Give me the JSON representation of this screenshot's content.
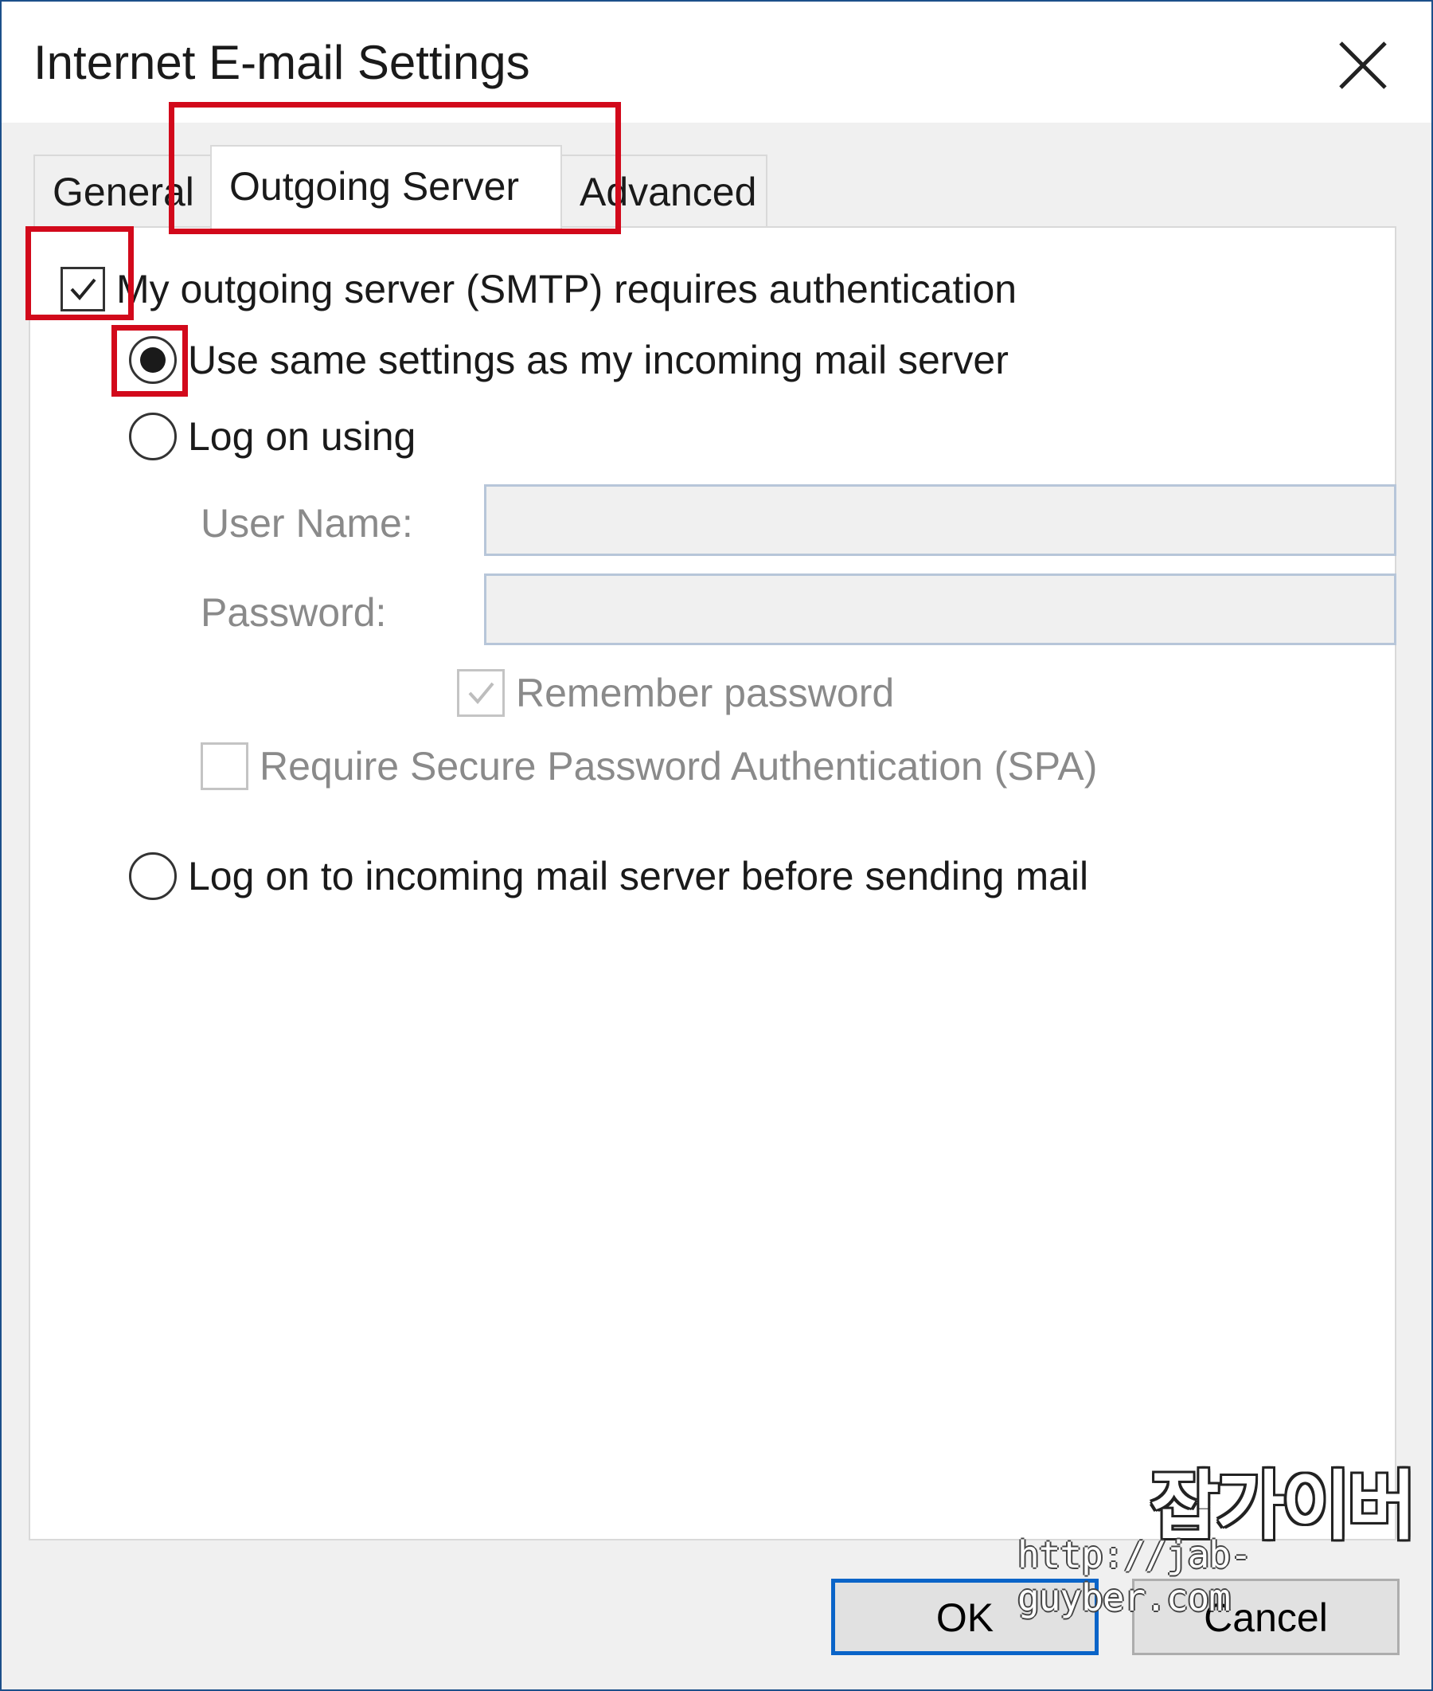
{
  "window": {
    "title": "Internet E-mail Settings",
    "close_icon": "close-icon"
  },
  "tabs": [
    {
      "label": "General",
      "active": false
    },
    {
      "label": "Outgoing Server",
      "active": true
    },
    {
      "label": "Advanced",
      "active": false
    }
  ],
  "outgoing": {
    "smtp_auth_label": "My outgoing server (SMTP) requires authentication",
    "smtp_auth_checked": true,
    "use_same_label": "Use same settings as my incoming mail server",
    "use_same_selected": true,
    "log_on_using_label": "Log on using",
    "log_on_using_selected": false,
    "user_name_label": "User Name:",
    "user_name_value": "",
    "password_label": "Password:",
    "password_value": "",
    "remember_password_label": "Remember password",
    "remember_password_checked": true,
    "spa_label": "Require Secure Password Authentication (SPA)",
    "spa_checked": false,
    "log_on_incoming_label": "Log on to incoming mail server before sending mail",
    "log_on_incoming_selected": false
  },
  "buttons": {
    "ok": "OK",
    "cancel": "Cancel"
  },
  "watermark": {
    "brand": "잡가이버",
    "url": "http://jab-guyber.com"
  },
  "colors": {
    "highlight": "#d2091b",
    "accent": "#0a64c8",
    "disabled_text": "#8a8a8a"
  }
}
